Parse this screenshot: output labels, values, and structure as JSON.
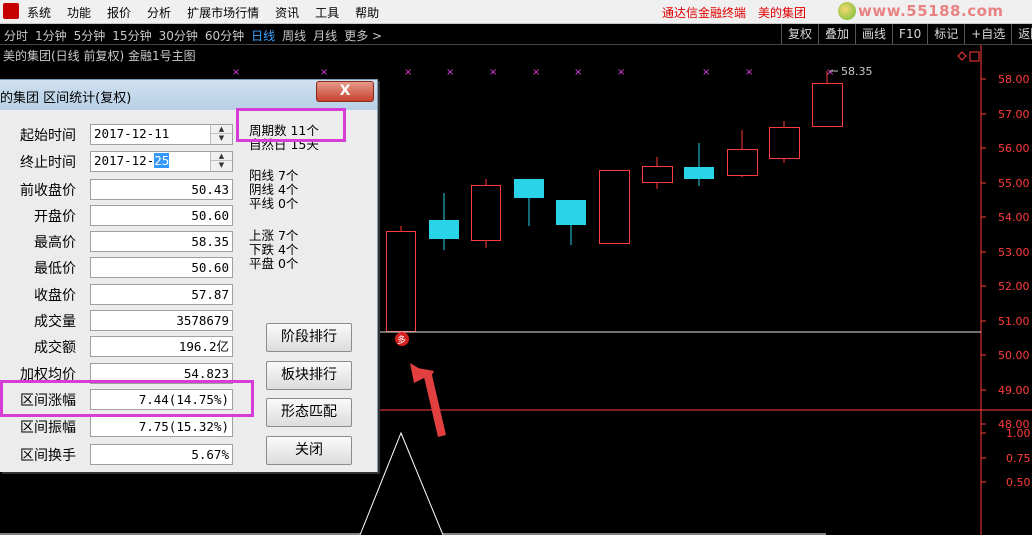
{
  "menubar": {
    "items": [
      "系统",
      "功能",
      "报价",
      "分析",
      "扩展市场行情",
      "资讯",
      "工具",
      "帮助"
    ],
    "brand_links": [
      "通达信金融终端",
      "美的集团"
    ],
    "site_logo_text": "www.55188.com"
  },
  "periodbar": {
    "tabs": [
      "分时",
      "1分钟",
      "5分钟",
      "15分钟",
      "30分钟",
      "60分钟",
      "日线",
      "周线",
      "月线",
      "更多 >"
    ],
    "active_tab": "日线",
    "tool_buttons": [
      "复权",
      "叠加",
      "画线",
      "F10",
      "标记",
      "+自选",
      "返回"
    ]
  },
  "chart": {
    "title": "美的集团(日线 前复权) 金融1号主图",
    "price_axis_labels": [
      "58.00",
      "57.00",
      "56.00",
      "55.00",
      "54.00",
      "53.00",
      "52.00",
      "51.00",
      "50.00",
      "49.00",
      "48.00"
    ],
    "indicator_axis_labels": [
      "1.00",
      "0.75",
      "0.50"
    ],
    "max_price_label": "58.35",
    "signal_badge": "多",
    "colors": {
      "up": "#ff3c3c",
      "down": "#29d3e8",
      "signal_mark": "#e040e0",
      "axis": "#ff3c3c",
      "arrow": "#e24040"
    }
  },
  "dialog": {
    "title": "的集团 区间统计(复权)",
    "close_label": "X",
    "start_date": {
      "label": "起始时间",
      "value": "2017-12-11"
    },
    "end_date": {
      "label": "终止时间",
      "value_prefix": "2017-12-",
      "value_selected": "25"
    },
    "fields": [
      {
        "label": "前收盘价",
        "value": "50.43"
      },
      {
        "label": "开盘价",
        "value": "50.60"
      },
      {
        "label": "最高价",
        "value": "58.35"
      },
      {
        "label": "最低价",
        "value": "50.60"
      },
      {
        "label": "收盘价",
        "value": "57.87"
      },
      {
        "label": "成交量",
        "value": "3578679"
      },
      {
        "label": "成交额",
        "value": "196.2亿"
      },
      {
        "label": "加权均价",
        "value": "54.823"
      },
      {
        "label": "区间涨幅",
        "value": "7.44(14.75%)"
      },
      {
        "label": "区间振幅",
        "value": "7.75(15.32%)"
      },
      {
        "label": "区间换手",
        "value": "5.67%"
      }
    ],
    "stats": {
      "period_count": "周期数  11个",
      "natural_days": "自然日  15天",
      "yang_line": "阳线  7个",
      "yin_line": "阴线  4个",
      "flat_line": "平线  0个",
      "rise": "上涨  7个",
      "fall": "下跌  4个",
      "flat": "平盘  0个"
    },
    "buttons": {
      "stage_rank": "阶段排行",
      "sector_rank": "板块排行",
      "pattern_match": "形态匹配",
      "close": "关闭"
    }
  }
}
